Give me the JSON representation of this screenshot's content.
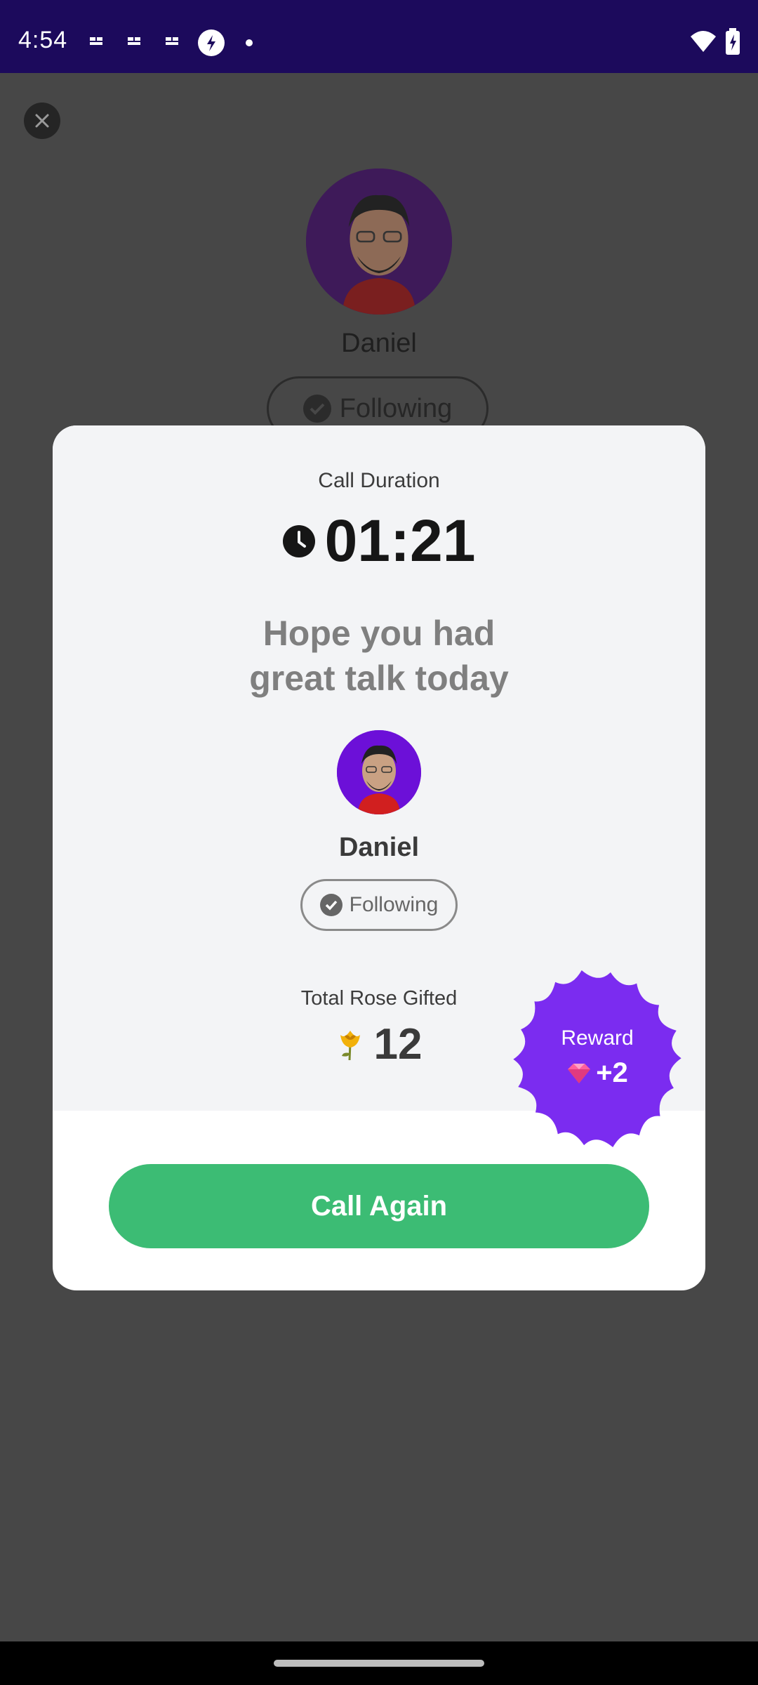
{
  "status_bar": {
    "time": "4:54"
  },
  "background": {
    "name": "Daniel",
    "follow_label": "Following"
  },
  "card": {
    "call_duration_label": "Call Duration",
    "duration": "01:21",
    "message_line1": "Hope you had",
    "message_line2": "great talk today",
    "user_name": "Daniel",
    "follow_label": "Following",
    "rose_label": "Total Rose Gifted",
    "rose_count": "12",
    "reward_label": "Reward",
    "reward_value": "+2",
    "call_again_label": "Call Again"
  },
  "colors": {
    "status_bar": "#1c0a5c",
    "reward_badge": "#7b2cf0",
    "call_button": "#3cbc74",
    "avatar_bg": "#6c10d8"
  },
  "icons": [
    "wifi-icon",
    "battery-icon",
    "close-icon",
    "clock-icon",
    "check-icon",
    "rose-icon",
    "gem-icon"
  ]
}
